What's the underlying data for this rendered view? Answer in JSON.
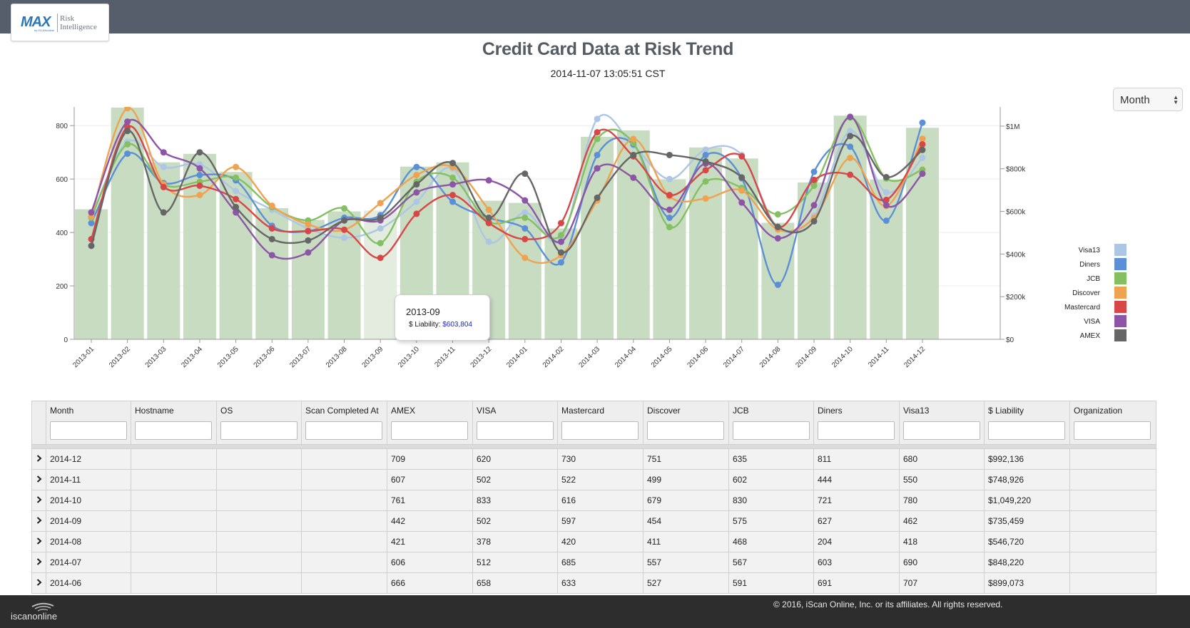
{
  "logo": {
    "brand": "MAX",
    "product_line1": "Risk",
    "product_line2": "Intelligence",
    "sub": "by iSCANonline"
  },
  "title": "Credit Card Data at Risk Trend",
  "subtitle": "2014-11-07 13:05:51 CST",
  "period_select": {
    "value": "Month"
  },
  "tooltip": {
    "title": "2013-09",
    "label": "$ Liability:",
    "value": "$603,804"
  },
  "chart_data": {
    "type": "bar+line",
    "categories": [
      "2013-01",
      "2013-02",
      "2013-03",
      "2013-04",
      "2013-05",
      "2013-06",
      "2013-07",
      "2013-08",
      "2013-09",
      "2013-10",
      "2013-11",
      "2013-12",
      "2014-01",
      "2014-02",
      "2014-03",
      "2014-04",
      "2014-05",
      "2014-06",
      "2014-07",
      "2014-08",
      "2014-09",
      "2014-10",
      "2014-11",
      "2014-12"
    ],
    "left_axis": {
      "ylim": [
        0,
        870
      ],
      "ticks": [
        "0",
        "200",
        "400",
        "600",
        "800"
      ]
    },
    "right_axis": {
      "ylim": [
        0,
        1090000
      ],
      "ticks": [
        "$0",
        "$200k",
        "$400k",
        "$600k",
        "$800k",
        "$1M"
      ]
    },
    "bars": {
      "name": "$ Liability",
      "color": "#c8dcc2",
      "values": [
        610000,
        1087000,
        830000,
        870000,
        785000,
        615000,
        560000,
        600000,
        603804,
        810000,
        830000,
        650000,
        640000,
        520000,
        950000,
        980000,
        750000,
        900000,
        848220,
        546720,
        735459,
        1049220,
        748926,
        992136
      ]
    },
    "series": [
      {
        "name": "Visa13",
        "color": "#adc6e5",
        "values": [
          460,
          740,
          645,
          655,
          555,
          485,
          415,
          380,
          415,
          515,
          640,
          365,
          475,
          375,
          825,
          725,
          600,
          710,
          690,
          418,
          462,
          780,
          550,
          680
        ]
      },
      {
        "name": "Diners",
        "color": "#5b8fd6",
        "values": [
          435,
          695,
          585,
          615,
          595,
          425,
          405,
          455,
          465,
          645,
          515,
          455,
          415,
          288,
          690,
          730,
          455,
          690,
          603,
          204,
          627,
          721,
          444,
          811
        ]
      },
      {
        "name": "JCB",
        "color": "#84c061",
        "values": [
          455,
          730,
          580,
          590,
          605,
          495,
          445,
          490,
          360,
          590,
          605,
          440,
          455,
          390,
          750,
          735,
          420,
          591,
          567,
          468,
          575,
          830,
          602,
          635
        ]
      },
      {
        "name": "Discover",
        "color": "#efa24f",
        "values": [
          460,
          865,
          580,
          540,
          645,
          500,
          430,
          410,
          510,
          615,
          645,
          485,
          305,
          315,
          520,
          750,
          535,
          527,
          557,
          411,
          454,
          679,
          499,
          751
        ]
      },
      {
        "name": "Mastercard",
        "color": "#d84747",
        "values": [
          375,
          795,
          570,
          575,
          525,
          415,
          405,
          410,
          305,
          470,
          540,
          435,
          375,
          435,
          775,
          685,
          540,
          633,
          685,
          420,
          597,
          616,
          522,
          730
        ]
      },
      {
        "name": "VISA",
        "color": "#8c55a6",
        "values": [
          475,
          815,
          700,
          640,
          475,
          315,
          325,
          445,
          445,
          550,
          580,
          595,
          520,
          365,
          640,
          605,
          485,
          658,
          512,
          378,
          502,
          833,
          502,
          620
        ]
      },
      {
        "name": "AMEX",
        "color": "#666666",
        "values": [
          350,
          780,
          475,
          700,
          495,
          375,
          370,
          445,
          455,
          580,
          660,
          455,
          620,
          325,
          530,
          690,
          690,
          666,
          606,
          421,
          442,
          761,
          607,
          709
        ]
      }
    ],
    "legend_position": "right",
    "grid": true
  },
  "table": {
    "columns": [
      "Month",
      "Hostname",
      "OS",
      "Scan Completed At",
      "AMEX",
      "VISA",
      "Mastercard",
      "Discover",
      "JCB",
      "Diners",
      "Visa13",
      "$ Liability",
      "Organization"
    ],
    "rows": [
      [
        "2014-12",
        "",
        "",
        "",
        "709",
        "620",
        "730",
        "751",
        "635",
        "811",
        "680",
        "$992,136",
        ""
      ],
      [
        "2014-11",
        "",
        "",
        "",
        "607",
        "502",
        "522",
        "499",
        "602",
        "444",
        "550",
        "$748,926",
        ""
      ],
      [
        "2014-10",
        "",
        "",
        "",
        "761",
        "833",
        "616",
        "679",
        "830",
        "721",
        "780",
        "$1,049,220",
        ""
      ],
      [
        "2014-09",
        "",
        "",
        "",
        "442",
        "502",
        "597",
        "454",
        "575",
        "627",
        "462",
        "$735,459",
        ""
      ],
      [
        "2014-08",
        "",
        "",
        "",
        "421",
        "378",
        "420",
        "411",
        "468",
        "204",
        "418",
        "$546,720",
        ""
      ],
      [
        "2014-07",
        "",
        "",
        "",
        "606",
        "512",
        "685",
        "557",
        "567",
        "603",
        "690",
        "$848,220",
        ""
      ],
      [
        "2014-06",
        "",
        "",
        "",
        "666",
        "658",
        "633",
        "527",
        "591",
        "691",
        "707",
        "$899,073",
        ""
      ]
    ]
  },
  "footer": {
    "brand": "iscanonline",
    "copyright": "© 2016, iScan Online, Inc. or its affiliates. All rights reserved."
  }
}
